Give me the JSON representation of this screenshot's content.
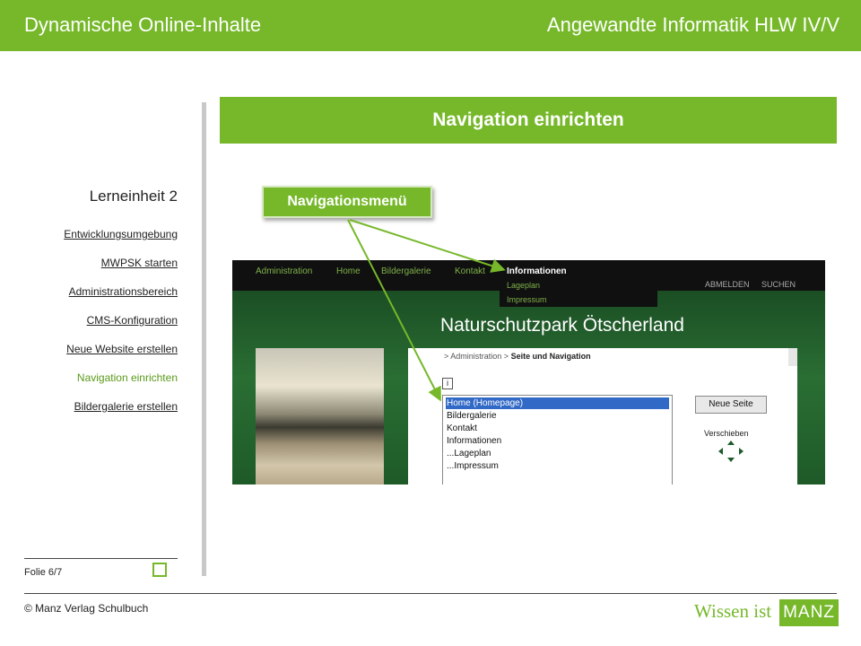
{
  "header": {
    "left_title": "Dynamische Online-Inhalte",
    "right_title": "Angewandte Informatik HLW IV/V"
  },
  "sidebar": {
    "title": "Lerneinheit 2",
    "items": [
      {
        "label": "Entwicklungsumgebung"
      },
      {
        "label": "MWPSK starten"
      },
      {
        "label": "Administrationsbereich"
      },
      {
        "label": "CMS-Konfiguration"
      },
      {
        "label": "Neue Website erstellen"
      },
      {
        "label": "Navigation einrichten"
      },
      {
        "label": "Bildergalerie erstellen"
      }
    ]
  },
  "content": {
    "title": "Navigation einrichten",
    "callout_button": "Navigationsmenü"
  },
  "cms": {
    "nav": [
      "Administration",
      "Home",
      "Bildergalerie",
      "Kontakt"
    ],
    "info_tab": "Informationen",
    "submenu": [
      "Lageplan",
      "Impressum"
    ],
    "top_right": [
      "ABMELDEN",
      "SUCHEN"
    ],
    "site_title": "Naturschutzpark Ötscherland",
    "breadcrumb": {
      "prefix": "> Administration >",
      "current": "Seite und Navigation"
    },
    "info_icon": "i",
    "list": [
      {
        "label": "Home (Homepage)",
        "selected": true
      },
      {
        "label": "Bildergalerie",
        "selected": false
      },
      {
        "label": "Kontakt",
        "selected": false
      },
      {
        "label": "Informationen",
        "selected": false
      },
      {
        "label": "...Lageplan",
        "selected": false
      },
      {
        "label": "...Impressum",
        "selected": false
      }
    ],
    "new_page_button": "Neue Seite",
    "move_label": "Verschieben"
  },
  "footer": {
    "slide": "Folie 6/7",
    "copyright": "© Manz Verlag Schulbuch",
    "logo_text": "Wissen ist",
    "logo_box": "MANZ"
  },
  "colors": {
    "accent": "#76b82a",
    "active_link": "#5a9a1a",
    "cms_dark": "#101010",
    "cms_green": "#1f5a2a",
    "list_selected": "#3169c6"
  }
}
